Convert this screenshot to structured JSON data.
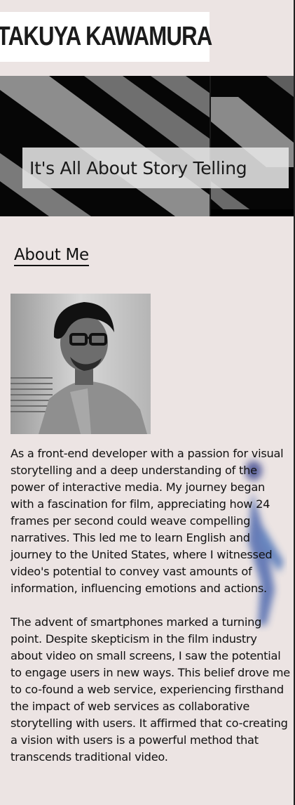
{
  "header": {
    "logo_text": "TAKUYA KAWAMURA"
  },
  "hero": {
    "title": "It's All About Story Telling"
  },
  "about": {
    "heading": "About Me",
    "portrait_alt": "Portrait photo",
    "paragraphs": [
      "As a front-end developer with a passion for visual storytelling and a deep understanding of the power of interactive media. My journey began with a fascination for film, appreciating how 24 frames per second could weave compelling narratives. This led me to learn English and journey to the United States, where I witnessed video's potential to convey vast amounts of information, influencing emotions and actions.",
      "The advent of smartphones marked a turning point. Despite skepticism in the film industry about video on small screens, I saw the potential to engage users in new ways. This belief drove me to co-found a web service, experiencing firsthand the impact of web services as collaborative storytelling with users. It affirmed that co-creating a vision with users is a powerful method that transcends traditional video."
    ]
  },
  "colors": {
    "page_background": "#ece4e3",
    "hero_background": "#050505",
    "text": "#111111"
  }
}
